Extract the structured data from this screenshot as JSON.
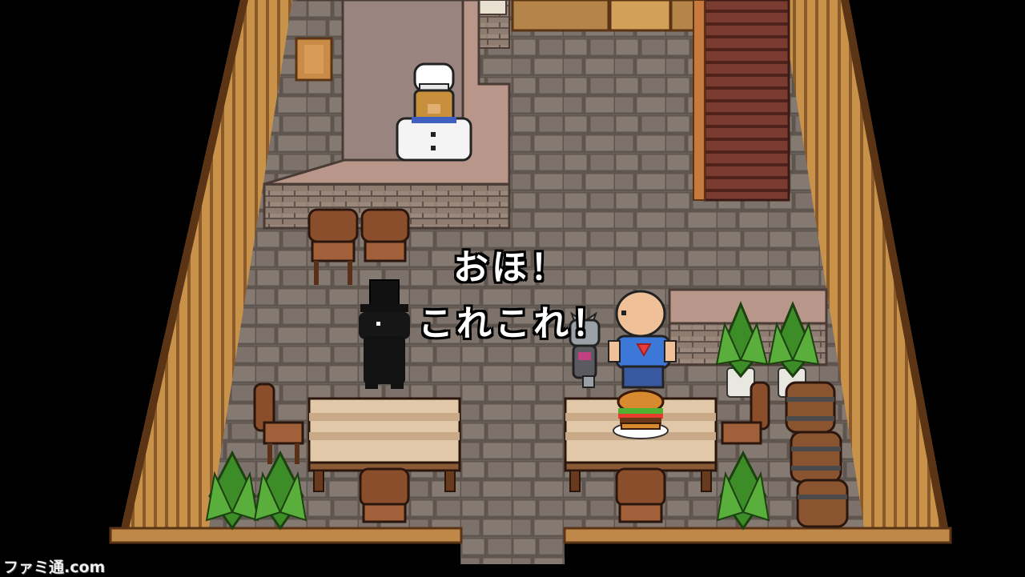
{
  "dialogue": {
    "line1": "おほ！",
    "line2": "これこれ！"
  },
  "watermark": "ファミ通.com",
  "colors": {
    "background": "#000000",
    "wood_wall": "#c8924a",
    "wood_wall_dark": "#8a5a28",
    "stone_floor": "#7a6f68",
    "stone_floor_line": "#5e554f",
    "counter_top": "#b8968a",
    "stairs": "#7a3c30",
    "table_top": "#e0c8a8",
    "chair": "#8a4e2c",
    "plant": "#3c8c28",
    "text": "#ffffff"
  },
  "characters": [
    {
      "name": "bear-chef"
    },
    {
      "name": "black-cat-top-hat"
    },
    {
      "name": "gray-cat"
    },
    {
      "name": "bald-man"
    }
  ]
}
